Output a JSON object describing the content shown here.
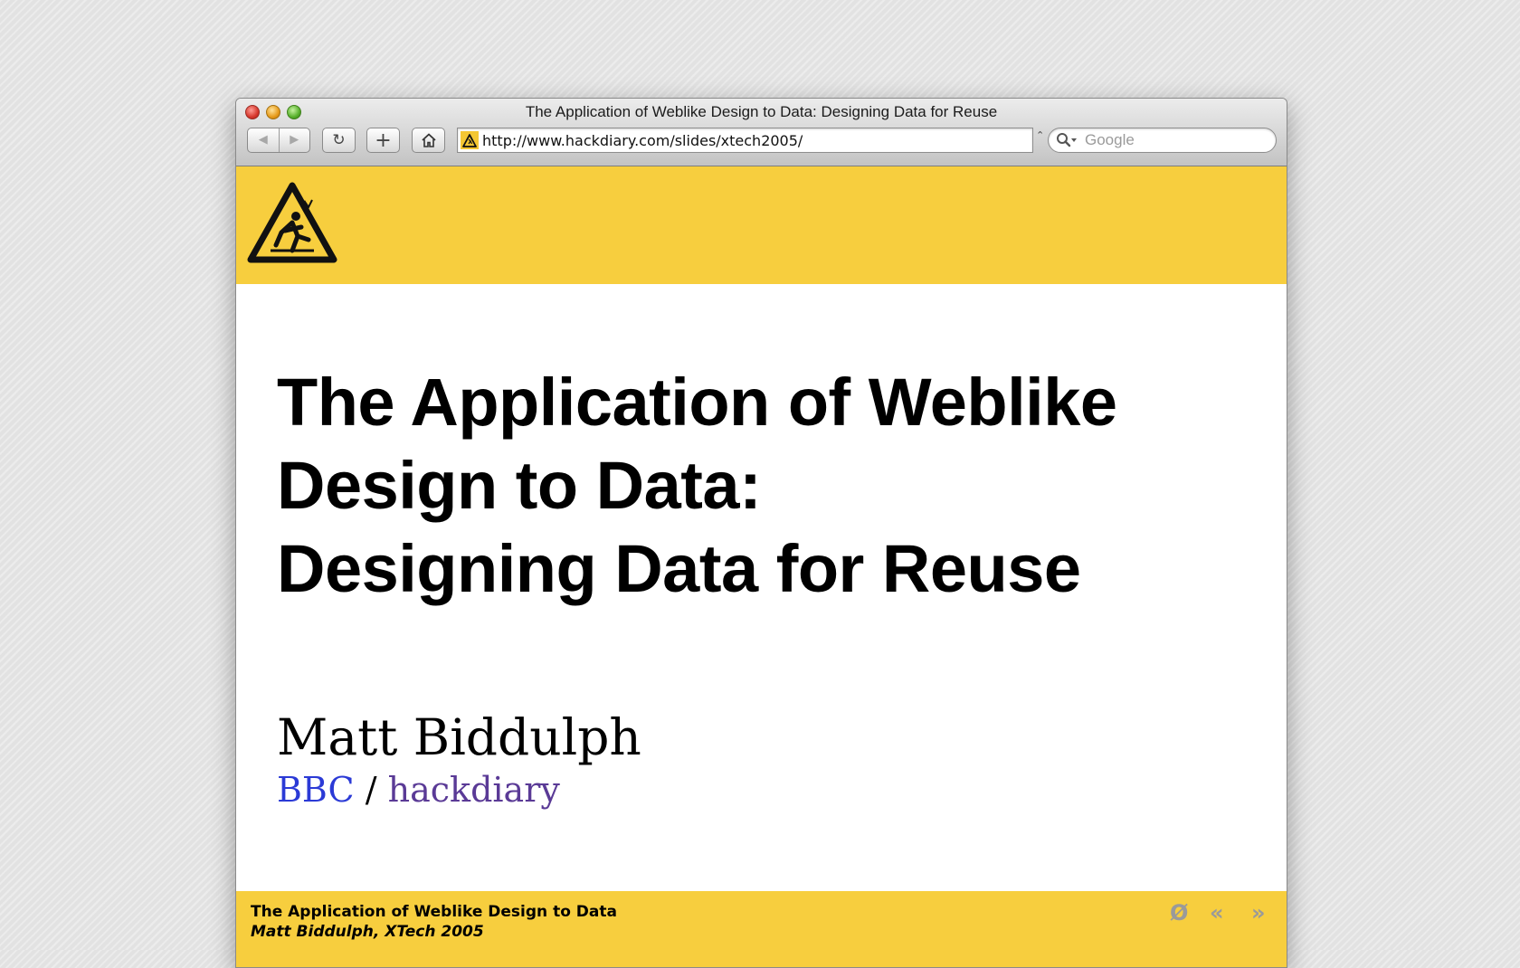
{
  "window": {
    "title": "The Application of Weblike Design to Data: Designing Data for Reuse"
  },
  "toolbar": {
    "back_icon": "◀",
    "forward_icon": "▶",
    "reload_icon": "↻",
    "add_bookmark_icon": "+",
    "home_icon": "home-icon"
  },
  "address_bar": {
    "url": "http://www.hackdiary.com/slides/xtech2005/"
  },
  "search": {
    "placeholder": "Google"
  },
  "slide": {
    "title_lines": [
      "The Application of Weblike",
      "Design to Data:",
      "Designing Data for Reuse"
    ],
    "author": "Matt Biddulph",
    "affiliation_1": "BBC",
    "separator": "/",
    "affiliation_2": "hackdiary"
  },
  "footer": {
    "title": "The Application of Weblike Design to Data",
    "subtitle": "Matt Biddulph, XTech 2005",
    "toggle_label": "Ø",
    "prev_label": "«",
    "next_label": "»"
  },
  "colors": {
    "band": "#f7ce3e",
    "bbc_link": "#2b3ad6",
    "hackdiary_link": "#5a3a96"
  }
}
